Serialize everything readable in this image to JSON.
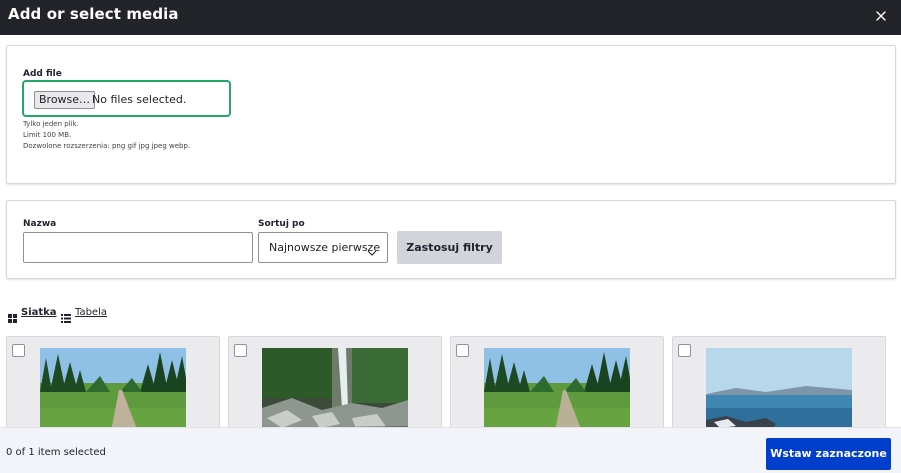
{
  "dialog": {
    "title": "Add or select media",
    "close_icon": "close-icon"
  },
  "upload": {
    "label": "Add file",
    "browse_label": "Browse…",
    "status": "No files selected.",
    "hints": [
      "Tylko jeden plik.",
      "Limit 100 MB.",
      "Dozwolone rozszerzenia: png gif jpg jpeg webp."
    ]
  },
  "filters": {
    "name_label": "Nazwa",
    "name_value": "",
    "sort_label": "Sortuj po",
    "sort_value": "Najnowsze pierwsze",
    "apply_label": "Zastosuj filtry"
  },
  "views": {
    "grid_label": "Siatka",
    "table_label": "Tabela",
    "grid_icon": "grid-icon",
    "table_icon": "list-icon"
  },
  "media_items": [
    {
      "thumb": "path-through-trees",
      "checked": false
    },
    {
      "thumb": "waterfall-rocks",
      "checked": false
    },
    {
      "thumb": "path-through-trees",
      "checked": false
    },
    {
      "thumb": "sea-coast",
      "checked": false
    }
  ],
  "footer": {
    "selection_count": "0 of 1 item selected",
    "insert_label": "Wstaw zaznaczone"
  },
  "colors": {
    "titlebar": "#232429",
    "focus_border": "#26a769",
    "primary_button": "#003ecc",
    "secondary_button": "#d3d4d9"
  }
}
